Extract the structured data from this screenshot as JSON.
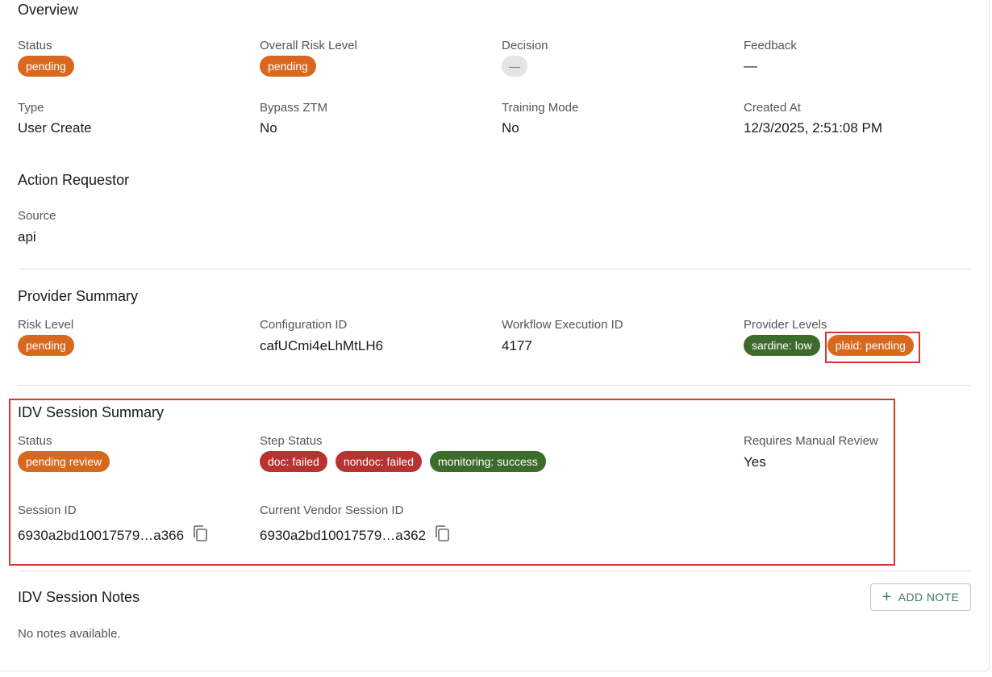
{
  "overview": {
    "title": "Overview",
    "status": {
      "label": "Status",
      "value": "pending"
    },
    "risk": {
      "label": "Overall Risk Level",
      "value": "pending"
    },
    "decision": {
      "label": "Decision",
      "value": "—"
    },
    "feedback": {
      "label": "Feedback",
      "value": "—"
    },
    "type": {
      "label": "Type",
      "value": "User Create"
    },
    "bypass": {
      "label": "Bypass ZTM",
      "value": "No"
    },
    "training": {
      "label": "Training Mode",
      "value": "No"
    },
    "created": {
      "label": "Created At",
      "value": "12/3/2025, 2:51:08 PM"
    }
  },
  "requestor": {
    "title": "Action Requestor",
    "source": {
      "label": "Source",
      "value": "api"
    }
  },
  "provider": {
    "title": "Provider Summary",
    "risk": {
      "label": "Risk Level",
      "value": "pending"
    },
    "config": {
      "label": "Configuration ID",
      "value": "cafUCmi4eLhMtLH6"
    },
    "workflow": {
      "label": "Workflow Execution ID",
      "value": "4177"
    },
    "levels": {
      "label": "Provider Levels",
      "items": [
        "sardine: low",
        "plaid: pending"
      ]
    }
  },
  "idv": {
    "title": "IDV Session Summary",
    "status": {
      "label": "Status",
      "value": "pending review"
    },
    "step": {
      "label": "Step Status",
      "items": [
        "doc: failed",
        "nondoc: failed",
        "monitoring: success"
      ]
    },
    "manual": {
      "label": "Requires Manual Review",
      "value": "Yes"
    },
    "session": {
      "label": "Session ID",
      "value": "6930a2bd10017579…a366"
    },
    "vendor": {
      "label": "Current Vendor Session ID",
      "value": "6930a2bd10017579…a362"
    }
  },
  "notes": {
    "title": "IDV Session Notes",
    "add_label": "ADD NOTE",
    "empty": "No notes available."
  },
  "colors": {
    "pending": "#d9681f",
    "failed": "#b83232",
    "success": "#3d6b2c",
    "highlight": "#d6382c",
    "button": "#3d7a52"
  }
}
